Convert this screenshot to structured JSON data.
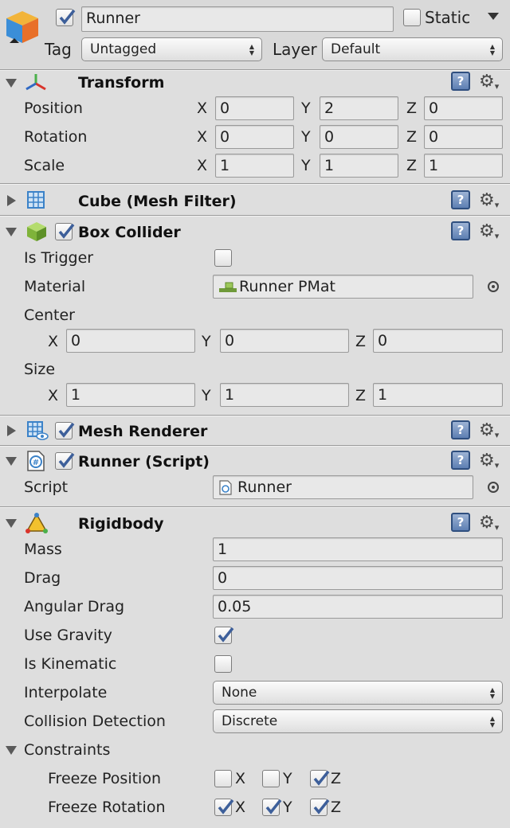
{
  "object": {
    "name": "Runner",
    "static_label": "Static",
    "tag_label": "Tag",
    "tag_value": "Untagged",
    "layer_label": "Layer",
    "layer_value": "Default"
  },
  "transform": {
    "title": "Transform",
    "position_label": "Position",
    "rotation_label": "Rotation",
    "scale_label": "Scale",
    "axes": {
      "x": "X",
      "y": "Y",
      "z": "Z"
    },
    "position": {
      "x": "0",
      "y": "2",
      "z": "0"
    },
    "rotation": {
      "x": "0",
      "y": "0",
      "z": "0"
    },
    "scale": {
      "x": "1",
      "y": "1",
      "z": "1"
    }
  },
  "mesh_filter": {
    "title": "Cube (Mesh Filter)"
  },
  "box_collider": {
    "title": "Box Collider",
    "is_trigger_label": "Is Trigger",
    "material_label": "Material",
    "material_value": "Runner PMat",
    "center_label": "Center",
    "center": {
      "x": "0",
      "y": "0",
      "z": "0"
    },
    "size_label": "Size",
    "size": {
      "x": "1",
      "y": "1",
      "z": "1"
    }
  },
  "mesh_renderer": {
    "title": "Mesh Renderer"
  },
  "runner_script": {
    "title": "Runner (Script)",
    "script_label": "Script",
    "script_value": "Runner"
  },
  "rigidbody": {
    "title": "Rigidbody",
    "mass_label": "Mass",
    "mass": "1",
    "drag_label": "Drag",
    "drag": "0",
    "angular_drag_label": "Angular Drag",
    "angular_drag": "0.05",
    "use_gravity_label": "Use Gravity",
    "is_kinematic_label": "Is Kinematic",
    "interpolate_label": "Interpolate",
    "interpolate": "None",
    "collision_label": "Collision Detection",
    "collision": "Discrete",
    "constraints_label": "Constraints",
    "freeze_position_label": "Freeze Position",
    "freeze_rotation_label": "Freeze Rotation"
  },
  "icons": {
    "help": "?",
    "gear": "⚙",
    "gear_arrow": "▾",
    "dropdown_up": "▲",
    "dropdown_down": "▼"
  },
  "colors": {
    "check": "#3d5f9a",
    "help_icon": "#5d7fb3",
    "cube_orange": "#e8702a",
    "cube_blue": "#3b8ed8"
  }
}
